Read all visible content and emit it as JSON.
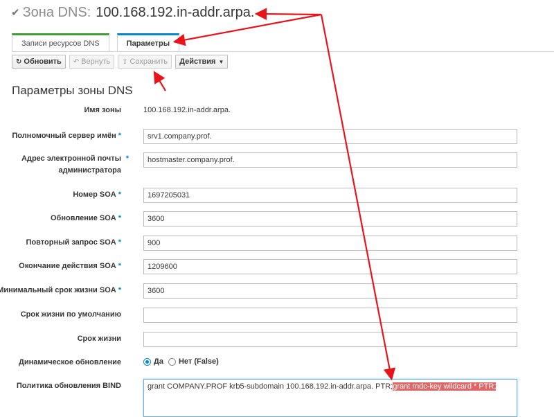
{
  "header": {
    "check_icon": "check-icon",
    "label": "Зона DNS:",
    "zone": "100.168.192.in-addr.arpa."
  },
  "tabs": [
    {
      "label": "Записи ресурсов DNS",
      "active": false
    },
    {
      "label": "Параметры",
      "active": true
    }
  ],
  "toolbar": {
    "refresh": {
      "label": "Обновить",
      "icon": "refresh-icon"
    },
    "revert": {
      "label": "Вернуть",
      "icon": "undo-icon"
    },
    "save": {
      "label": "Сохранить",
      "icon": "upload-icon"
    },
    "actions": {
      "label": "Действия",
      "icon": "caret-down-icon"
    }
  },
  "section_title": "Параметры зоны DNS",
  "fields": {
    "zone_name": {
      "label": "Имя зоны",
      "value": "100.168.192.in-addr.arpa."
    },
    "authoritative_ns": {
      "label": "Полномочный сервер имён",
      "value": "srv1.company.prof."
    },
    "admin_email": {
      "label": "Адрес электронной почты администратора",
      "value": "hostmaster.company.prof."
    },
    "soa_serial": {
      "label": "Номер SOA",
      "value": "1697205031"
    },
    "soa_refresh": {
      "label": "Обновление SOA",
      "value": "3600"
    },
    "soa_retry": {
      "label": "Повторный запрос SOA",
      "value": "900"
    },
    "soa_expire": {
      "label": "Окончание действия SOA",
      "value": "1209600"
    },
    "soa_minimum": {
      "label": "Минимальный срок жизни SOA",
      "value": "3600"
    },
    "default_ttl": {
      "label": "Срок жизни по умолчанию",
      "value": ""
    },
    "ttl": {
      "label": "Срок жизни",
      "value": ""
    },
    "dynamic_update": {
      "label": "Динамическое обновление",
      "options": [
        "Да",
        "Нет (False)"
      ],
      "selected": "Да"
    },
    "bind_policy": {
      "label": "Политика обновления BIND",
      "value_plain": "grant COMPANY.PROF krb5-subdomain 100.168.192.in-addr.arpa. PTR;",
      "value_highlighted": "grant rndc-key wildcard * PTR;"
    }
  },
  "required_marker": "*",
  "colors": {
    "accent": "#0088ce",
    "tab_green": "#3f9c35",
    "annotation_red": "#e8141b",
    "highlight": "#e06666"
  }
}
